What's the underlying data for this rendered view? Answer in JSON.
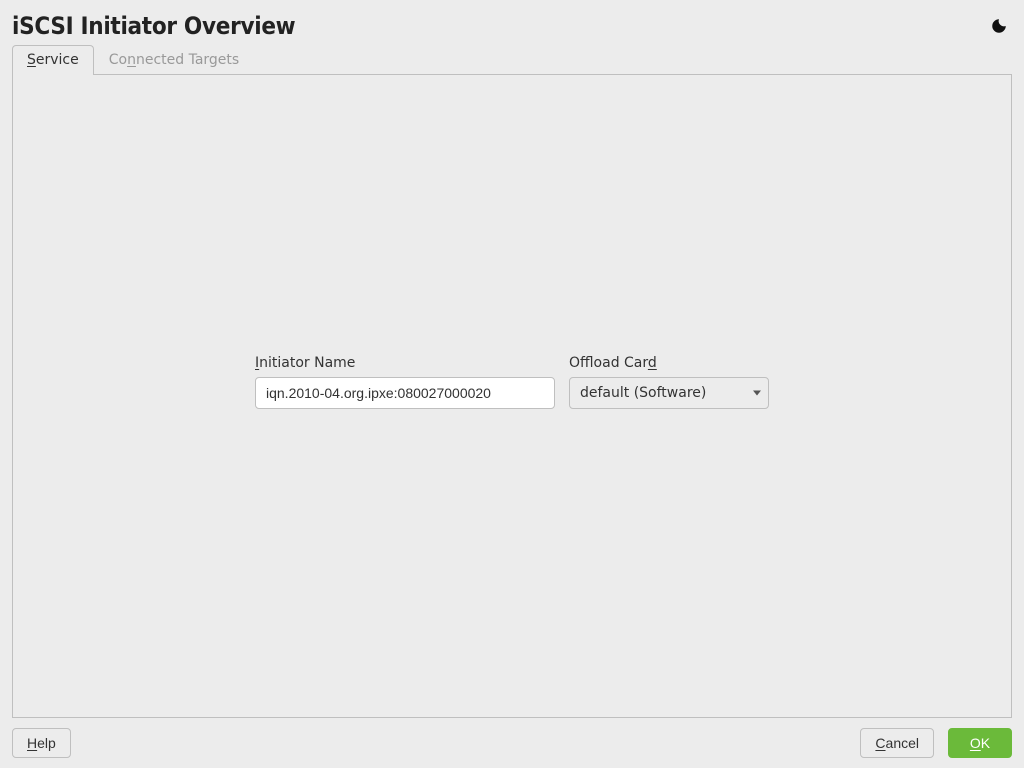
{
  "header": {
    "title": "iSCSI Initiator Overview"
  },
  "tabs": {
    "service": {
      "pre": "S",
      "rest": "ervice"
    },
    "connected": {
      "pre": "Co",
      "mn": "n",
      "rest": "nected Targets"
    }
  },
  "form": {
    "initiator": {
      "label_pre": "I",
      "label_rest": "nitiator Name",
      "value": "iqn.2010-04.org.ipxe:080027000020"
    },
    "offload": {
      "label_pre": "Offload Car",
      "label_mn": "d",
      "selected": "default (Software)"
    }
  },
  "footer": {
    "help_mn": "H",
    "help_rest": "elp",
    "cancel_mn": "C",
    "cancel_rest": "ancel",
    "ok_mn": "O",
    "ok_rest": "K"
  }
}
